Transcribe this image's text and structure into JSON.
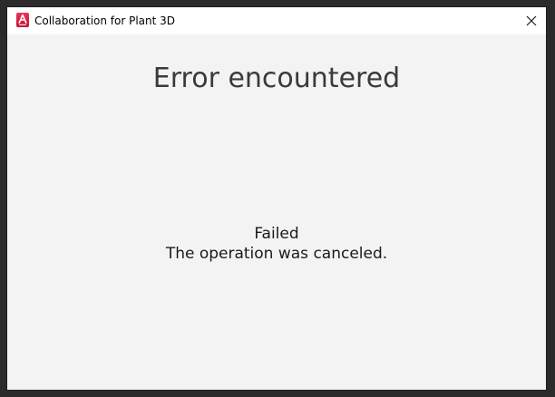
{
  "window": {
    "title": "Collaboration for Plant 3D",
    "app_icon": "autocad-app-icon",
    "close_icon": "close-icon"
  },
  "dialog": {
    "heading": "Error encountered",
    "status": "Failed",
    "detail": "The operation was canceled."
  },
  "colors": {
    "app_icon": "#d8193f",
    "background": "#f3f3f3",
    "titlebar": "#ffffff"
  }
}
